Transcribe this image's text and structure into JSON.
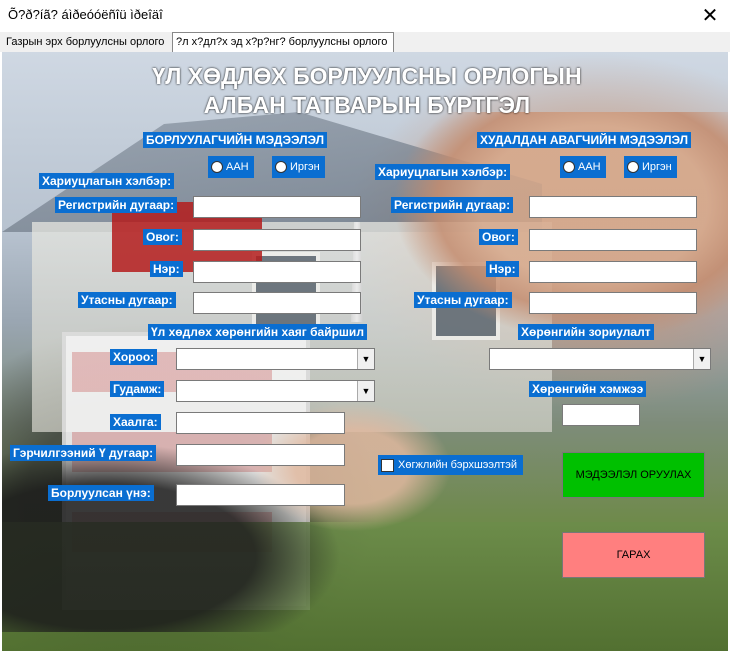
{
  "window": {
    "title": "Õ?ð?íã? áìðeóóëñîü ìðeîäî",
    "close_glyph": "✕"
  },
  "tabs": [
    {
      "label": "Газрын эрх борлуулсны орлого"
    },
    {
      "label": "?л х?дл?х эд х?р?нг? борлуулсны орлого"
    }
  ],
  "heading": {
    "line1": "ҮЛ ХӨДЛӨХ БОРЛУУЛСНЫ ОРЛОГЫН",
    "line2": "АЛБАН ТАТВАРЫН БҮРТГЭЛ"
  },
  "seller": {
    "title": "БОРЛУУЛАГЧИЙН МЭДЭЭЛЭЛ",
    "type_label": "Хариуцлагын хэлбэр:",
    "option_company": "ААН",
    "option_citizen": "Иргэн",
    "reg_label": "Регистрийн дугаар:",
    "lastname_label": "Овог:",
    "name_label": "Нэр:",
    "phone_label": "Утасны дугаар:"
  },
  "buyer": {
    "title": "ХУДАЛДАН АВАГЧИЙН МЭДЭЭЛЭЛ",
    "type_label": "Хариуцлагын хэлбэр:",
    "option_company": "ААН",
    "option_citizen": "Иргэн",
    "reg_label": "Регистрийн дугаар:",
    "lastname_label": "Овог:",
    "name_label": "Нэр:",
    "phone_label": "Утасны дугаар:"
  },
  "property": {
    "address_title": "Үл хөдлөх хөрөнгийн хаяг байршил",
    "khoroo_label": "Хороо:",
    "street_label": "Гудамж:",
    "door_label": "Хаалга:",
    "cert_label": "Гэрчилгээний Ү дугаар:",
    "price_label": "Борлуулсан үнэ:",
    "purpose_title": "Хөрөнгийн зориулалт",
    "size_title": "Хөрөнгийн хэмжээ",
    "disabled_check": "Хөгжлийн бэрхшээлтэй"
  },
  "buttons": {
    "submit": "МЭДЭЭЛЭЛ ОРУУЛАХ",
    "exit": "ГАРАХ"
  },
  "colors": {
    "label_bg": "#0a6ed1",
    "submit_bg": "#00c000",
    "exit_bg": "#ff7f7f"
  }
}
